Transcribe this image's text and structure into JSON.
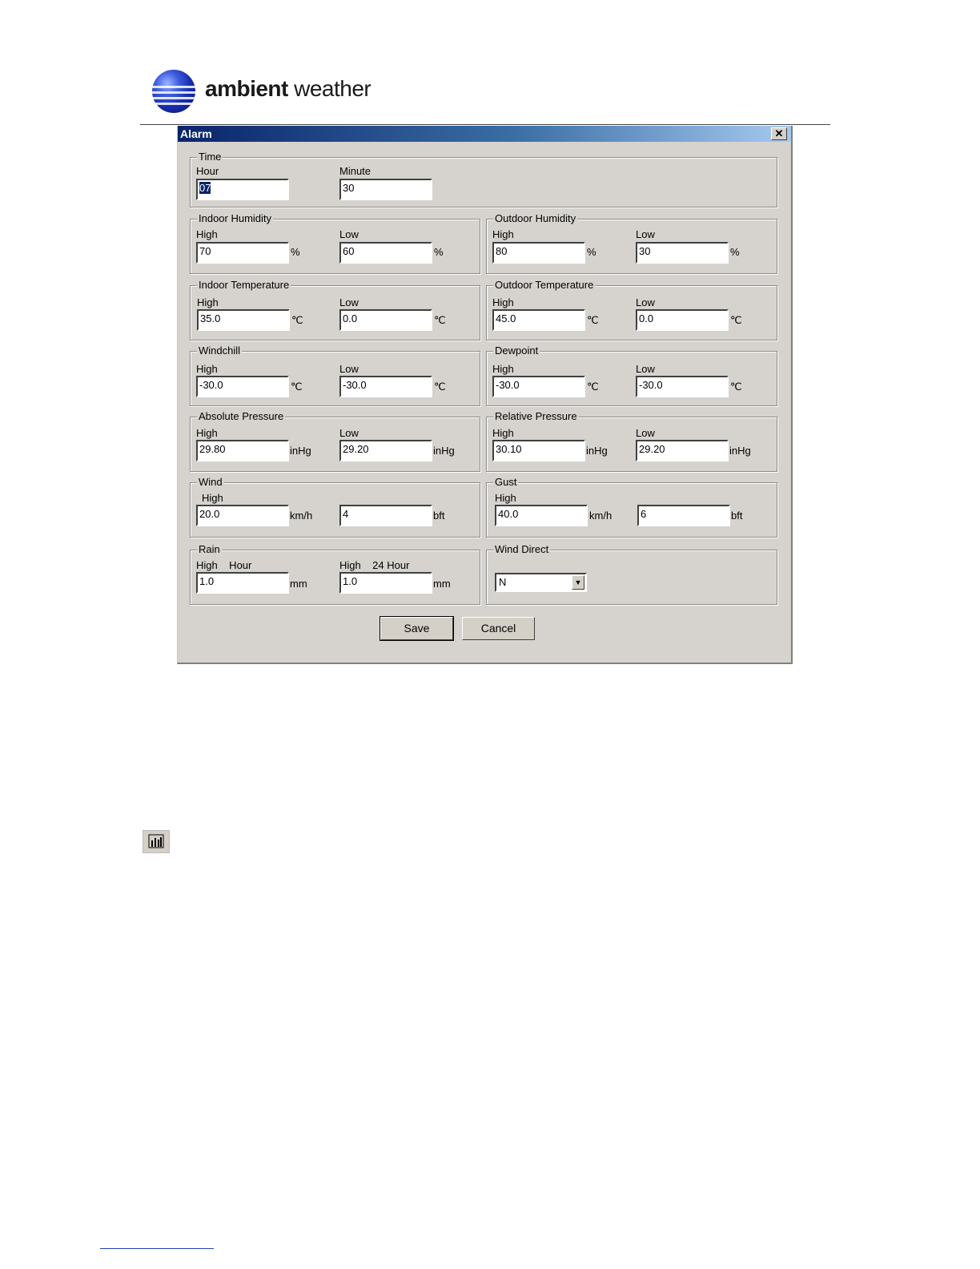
{
  "header": {
    "brand_bold": "ambient",
    "brand_light": "weather"
  },
  "dialog": {
    "title": "Alarm",
    "close_symbol": "✕",
    "time": {
      "title": "Time",
      "hour_label": "Hour",
      "hour_value": "07",
      "minute_label": "Minute",
      "minute_value": "30"
    },
    "indoor_humidity": {
      "title": "Indoor Humidity",
      "high_label": "High",
      "high": "70",
      "low_label": "Low",
      "low": "60",
      "unit": "%"
    },
    "outdoor_humidity": {
      "title": "Outdoor Humidity",
      "high_label": "High",
      "high": "80",
      "low_label": "Low",
      "low": "30",
      "unit": "%"
    },
    "indoor_temperature": {
      "title": "Indoor Temperature",
      "high_label": "High",
      "high": "35.0",
      "low_label": "Low",
      "low": "0.0",
      "unit": "℃"
    },
    "outdoor_temperature": {
      "title": "Outdoor Temperature",
      "high_label": "High",
      "high": "45.0",
      "low_label": "Low",
      "low": "0.0",
      "unit": "℃"
    },
    "windchill": {
      "title": "Windchill",
      "high_label": "High",
      "high": "-30.0",
      "low_label": "Low",
      "low": "-30.0",
      "unit": "℃"
    },
    "dewpoint": {
      "title": "Dewpoint",
      "high_label": "High",
      "high": "-30.0",
      "low_label": "Low",
      "low": "-30.0",
      "unit": "℃"
    },
    "absolute_pressure": {
      "title": "Absolute Pressure",
      "high_label": "High",
      "high": "29.80",
      "low_label": "Low",
      "low": "29.20",
      "unit": "inHg"
    },
    "relative_pressure": {
      "title": "Relative Pressure",
      "high_label": "High",
      "high": "30.10",
      "low_label": "Low",
      "low": "29.20",
      "unit": "inHg"
    },
    "wind": {
      "title": "Wind",
      "high_label": "High",
      "speed": "20.0",
      "speed_unit": "km/h",
      "bft": "4",
      "bft_unit": "bft"
    },
    "gust": {
      "title": "Gust",
      "high_label": "High",
      "speed": "40.0",
      "speed_unit": "km/h",
      "bft": "6",
      "bft_unit": "bft"
    },
    "rain": {
      "title": "Rain",
      "hour_label": "High    Hour",
      "hour_value": "1.0",
      "day_label": "High    24 Hour",
      "day_value": "1.0",
      "unit": "mm"
    },
    "wind_direct": {
      "title": "Wind Direct",
      "selected": "N",
      "arrow": "▼"
    },
    "buttons": {
      "save": "Save",
      "cancel": "Cancel"
    }
  },
  "icons": {
    "logo": "globe-logo-icon",
    "toolbar": "bar-chart-icon",
    "close": "close-icon",
    "dropdown": "chevron-down-icon"
  }
}
